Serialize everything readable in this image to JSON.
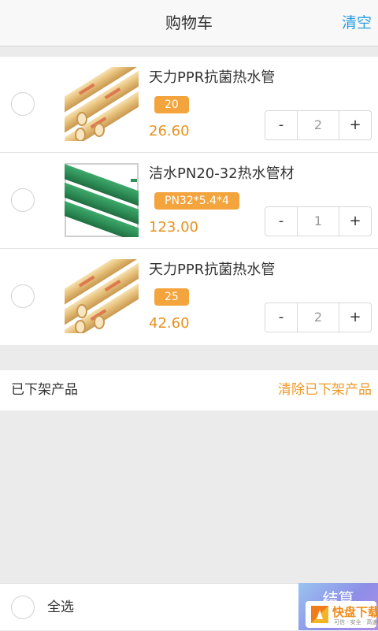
{
  "header": {
    "title": "购物车",
    "clear_label": "清空"
  },
  "cart": {
    "items": [
      {
        "name": "天力PPR抗菌热水管",
        "spec": "20",
        "price": "26.60",
        "quantity": "2",
        "image": "yellow-ppr-pipes-image",
        "minus_label": "-",
        "plus_label": "+"
      },
      {
        "name": "洁水PN20-32热水管材",
        "spec": "PN32*5.4*4",
        "price": "123.00",
        "quantity": "1",
        "image": "green-pipes-image",
        "minus_label": "-",
        "plus_label": "+"
      },
      {
        "name": "天力PPR抗菌热水管",
        "spec": "25",
        "price": "42.60",
        "quantity": "2",
        "image": "yellow-ppr-pipes-image",
        "minus_label": "-",
        "plus_label": "+"
      }
    ]
  },
  "offshelf": {
    "label": "已下架产品",
    "clear_label": "清除已下架产品"
  },
  "footer": {
    "select_all_label": "全选",
    "checkout_label": "结算"
  },
  "watermark": {
    "text": "快盘下载",
    "slogan": "可信 · 安全 · 高速"
  },
  "colors": {
    "accent_blue": "#2a9de0",
    "price_orange": "#e8911f",
    "badge_orange": "#f3a43c",
    "background": "#ebebeb"
  }
}
